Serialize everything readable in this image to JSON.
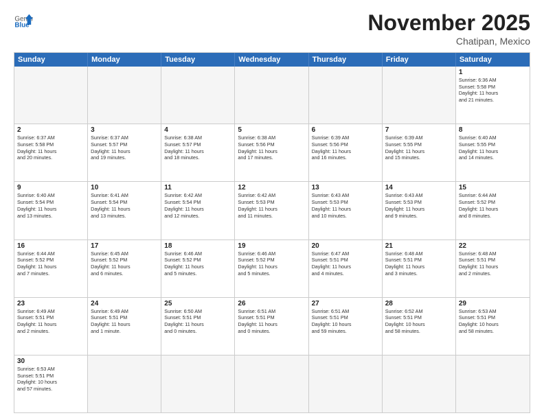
{
  "header": {
    "logo_general": "General",
    "logo_blue": "Blue",
    "month_year": "November 2025",
    "location": "Chatipan, Mexico"
  },
  "days_of_week": [
    "Sunday",
    "Monday",
    "Tuesday",
    "Wednesday",
    "Thursday",
    "Friday",
    "Saturday"
  ],
  "weeks": [
    [
      {
        "day": "",
        "text": ""
      },
      {
        "day": "",
        "text": ""
      },
      {
        "day": "",
        "text": ""
      },
      {
        "day": "",
        "text": ""
      },
      {
        "day": "",
        "text": ""
      },
      {
        "day": "",
        "text": ""
      },
      {
        "day": "1",
        "text": "Sunrise: 6:36 AM\nSunset: 5:58 PM\nDaylight: 11 hours\nand 21 minutes."
      }
    ],
    [
      {
        "day": "2",
        "text": "Sunrise: 6:37 AM\nSunset: 5:58 PM\nDaylight: 11 hours\nand 20 minutes."
      },
      {
        "day": "3",
        "text": "Sunrise: 6:37 AM\nSunset: 5:57 PM\nDaylight: 11 hours\nand 19 minutes."
      },
      {
        "day": "4",
        "text": "Sunrise: 6:38 AM\nSunset: 5:57 PM\nDaylight: 11 hours\nand 18 minutes."
      },
      {
        "day": "5",
        "text": "Sunrise: 6:38 AM\nSunset: 5:56 PM\nDaylight: 11 hours\nand 17 minutes."
      },
      {
        "day": "6",
        "text": "Sunrise: 6:39 AM\nSunset: 5:56 PM\nDaylight: 11 hours\nand 16 minutes."
      },
      {
        "day": "7",
        "text": "Sunrise: 6:39 AM\nSunset: 5:55 PM\nDaylight: 11 hours\nand 15 minutes."
      },
      {
        "day": "8",
        "text": "Sunrise: 6:40 AM\nSunset: 5:55 PM\nDaylight: 11 hours\nand 14 minutes."
      }
    ],
    [
      {
        "day": "9",
        "text": "Sunrise: 6:40 AM\nSunset: 5:54 PM\nDaylight: 11 hours\nand 13 minutes."
      },
      {
        "day": "10",
        "text": "Sunrise: 6:41 AM\nSunset: 5:54 PM\nDaylight: 11 hours\nand 13 minutes."
      },
      {
        "day": "11",
        "text": "Sunrise: 6:42 AM\nSunset: 5:54 PM\nDaylight: 11 hours\nand 12 minutes."
      },
      {
        "day": "12",
        "text": "Sunrise: 6:42 AM\nSunset: 5:53 PM\nDaylight: 11 hours\nand 11 minutes."
      },
      {
        "day": "13",
        "text": "Sunrise: 6:43 AM\nSunset: 5:53 PM\nDaylight: 11 hours\nand 10 minutes."
      },
      {
        "day": "14",
        "text": "Sunrise: 6:43 AM\nSunset: 5:53 PM\nDaylight: 11 hours\nand 9 minutes."
      },
      {
        "day": "15",
        "text": "Sunrise: 6:44 AM\nSunset: 5:52 PM\nDaylight: 11 hours\nand 8 minutes."
      }
    ],
    [
      {
        "day": "16",
        "text": "Sunrise: 6:44 AM\nSunset: 5:52 PM\nDaylight: 11 hours\nand 7 minutes."
      },
      {
        "day": "17",
        "text": "Sunrise: 6:45 AM\nSunset: 5:52 PM\nDaylight: 11 hours\nand 6 minutes."
      },
      {
        "day": "18",
        "text": "Sunrise: 6:46 AM\nSunset: 5:52 PM\nDaylight: 11 hours\nand 5 minutes."
      },
      {
        "day": "19",
        "text": "Sunrise: 6:46 AM\nSunset: 5:52 PM\nDaylight: 11 hours\nand 5 minutes."
      },
      {
        "day": "20",
        "text": "Sunrise: 6:47 AM\nSunset: 5:51 PM\nDaylight: 11 hours\nand 4 minutes."
      },
      {
        "day": "21",
        "text": "Sunrise: 6:48 AM\nSunset: 5:51 PM\nDaylight: 11 hours\nand 3 minutes."
      },
      {
        "day": "22",
        "text": "Sunrise: 6:48 AM\nSunset: 5:51 PM\nDaylight: 11 hours\nand 2 minutes."
      }
    ],
    [
      {
        "day": "23",
        "text": "Sunrise: 6:49 AM\nSunset: 5:51 PM\nDaylight: 11 hours\nand 2 minutes."
      },
      {
        "day": "24",
        "text": "Sunrise: 6:49 AM\nSunset: 5:51 PM\nDaylight: 11 hours\nand 1 minute."
      },
      {
        "day": "25",
        "text": "Sunrise: 6:50 AM\nSunset: 5:51 PM\nDaylight: 11 hours\nand 0 minutes."
      },
      {
        "day": "26",
        "text": "Sunrise: 6:51 AM\nSunset: 5:51 PM\nDaylight: 11 hours\nand 0 minutes."
      },
      {
        "day": "27",
        "text": "Sunrise: 6:51 AM\nSunset: 5:51 PM\nDaylight: 10 hours\nand 59 minutes."
      },
      {
        "day": "28",
        "text": "Sunrise: 6:52 AM\nSunset: 5:51 PM\nDaylight: 10 hours\nand 58 minutes."
      },
      {
        "day": "29",
        "text": "Sunrise: 6:53 AM\nSunset: 5:51 PM\nDaylight: 10 hours\nand 58 minutes."
      }
    ],
    [
      {
        "day": "30",
        "text": "Sunrise: 6:53 AM\nSunset: 5:51 PM\nDaylight: 10 hours\nand 57 minutes."
      },
      {
        "day": "",
        "text": ""
      },
      {
        "day": "",
        "text": ""
      },
      {
        "day": "",
        "text": ""
      },
      {
        "day": "",
        "text": ""
      },
      {
        "day": "",
        "text": ""
      },
      {
        "day": "",
        "text": ""
      }
    ]
  ]
}
